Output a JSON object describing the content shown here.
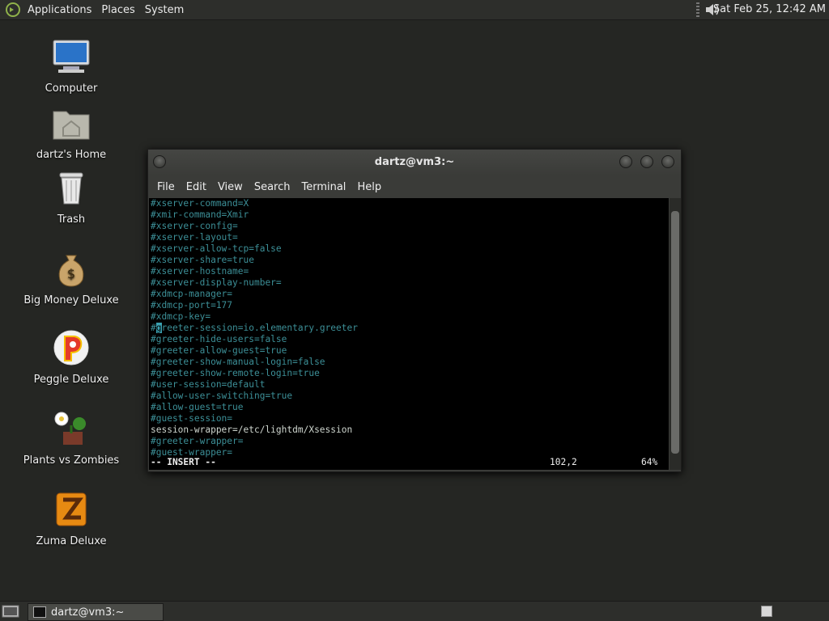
{
  "top_panel": {
    "menus": [
      "Applications",
      "Places",
      "System"
    ],
    "clock": "Sat Feb 25, 12:42 AM"
  },
  "desktop_icons": [
    {
      "label": "Computer",
      "icon": "computer-icon"
    },
    {
      "label": "dartz's Home",
      "icon": "home-folder-icon"
    },
    {
      "label": "Trash",
      "icon": "trash-icon"
    },
    {
      "label": "Big Money Deluxe",
      "icon": "money-bag-icon"
    },
    {
      "label": "Peggle Deluxe",
      "icon": "peggle-icon"
    },
    {
      "label": "Plants vs Zombies",
      "icon": "plants-vs-zombies-icon"
    },
    {
      "label": "Zuma Deluxe",
      "icon": "zuma-icon"
    }
  ],
  "terminal": {
    "title": "dartz@vm3:~",
    "menu": [
      "File",
      "Edit",
      "View",
      "Search",
      "Terminal",
      "Help"
    ],
    "lines": [
      "#xserver-command=X",
      "#xmir-command=Xmir",
      "#xserver-config=",
      "#xserver-layout=",
      "#xserver-allow-tcp=false",
      "#xserver-share=true",
      "#xserver-hostname=",
      "#xserver-display-number=",
      "#xdmcp-manager=",
      "#xdmcp-port=177",
      "#xdmcp-key=",
      "#greeter-session=io.elementary.greeter",
      "#greeter-hide-users=false",
      "#greeter-allow-guest=true",
      "#greeter-show-manual-login=false",
      "#greeter-show-remote-login=true",
      "#user-session=default",
      "#allow-user-switching=true",
      "#allow-guest=true",
      "#guest-session=",
      "session-wrapper=/etc/lightdm/Xsession",
      "#greeter-wrapper=",
      "#guest-wrapper="
    ],
    "status": {
      "mode": "-- INSERT --",
      "position": "102,2",
      "percent": "64%"
    }
  },
  "bottom_panel": {
    "task": "dartz@vm3:~"
  }
}
